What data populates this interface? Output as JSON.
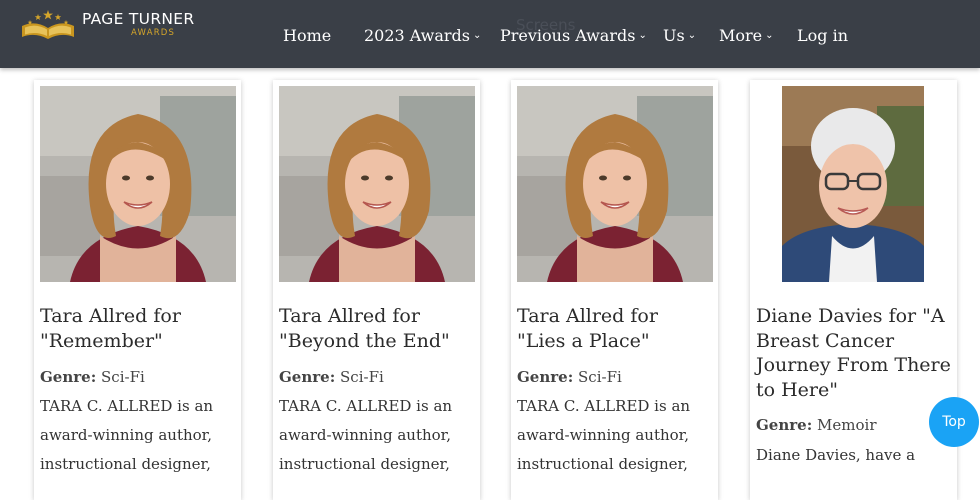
{
  "header": {
    "logo_name": "PAGE TURNER",
    "logo_sub": "AWARDS",
    "nav": [
      {
        "label": "Home",
        "has_dropdown": false
      },
      {
        "label": "2023 Awards",
        "has_dropdown": true
      },
      {
        "label": "Previous Awards",
        "has_dropdown": true
      },
      {
        "label": "Us",
        "has_dropdown": true
      },
      {
        "label": "More",
        "has_dropdown": true
      },
      {
        "label": "Log in",
        "has_dropdown": false
      }
    ],
    "ghost_text": "Screens"
  },
  "cards": [
    {
      "title": "Tara Allred for \"Remember\"",
      "genre_label": "Genre:",
      "genre_value": "Sci-Fi",
      "bio_lines": [
        "TARA C. ALLRED is an",
        "award-winning author,",
        "instructional designer,"
      ]
    },
    {
      "title": "Tara Allred for \"Beyond the End\"",
      "genre_label": "Genre:",
      "genre_value": "Sci-Fi",
      "bio_lines": [
        "TARA C. ALLRED is an",
        "award-winning author,",
        "instructional designer,"
      ]
    },
    {
      "title": "Tara Allred for \"Lies a Place\"",
      "genre_label": "Genre:",
      "genre_value": "Sci-Fi",
      "bio_lines": [
        "TARA C. ALLRED is an",
        "award-winning author,",
        "instructional designer,"
      ]
    },
    {
      "title": "Diane Davies for \"A Breast Cancer Journey From There to Here\"",
      "genre_label": "Genre:",
      "genre_value": "Memoir",
      "bio_lines": [
        "Diane Davies, have a"
      ]
    }
  ],
  "top_button": "Top",
  "colors": {
    "navbar": "#3a3f47",
    "gold": "#d4a52b",
    "top_button": "#1aa3f5"
  }
}
